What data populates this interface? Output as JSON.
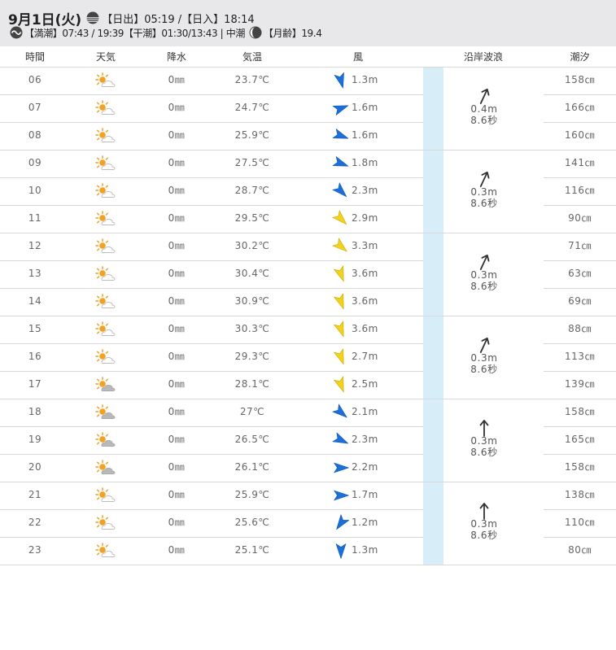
{
  "header": {
    "date": "9月1日(火)",
    "sun_text": "【日出】05:19 /【日入】18:14",
    "tide_text": "【満潮】07:43 / 19:39【干潮】01:30/13:43 | 中潮",
    "moon_text": "【月齢】19.4"
  },
  "columns": [
    "時間",
    "天気",
    "降水",
    "気温",
    "風",
    "沿岸波浪",
    "潮汐"
  ],
  "rows": [
    {
      "hour": "06",
      "weather": "sunny-cloudy-icon",
      "rain": "0㎜",
      "temp": "23.7℃",
      "wind_dir": 165,
      "wind_color": "#1a6fd8",
      "wind": "1.3m",
      "tide": "158㎝"
    },
    {
      "hour": "07",
      "weather": "sunny-cloudy-icon",
      "rain": "0㎜",
      "temp": "24.7℃",
      "wind_dir": 70,
      "wind_color": "#1a6fd8",
      "wind": "1.6m",
      "tide": "166㎝"
    },
    {
      "hour": "08",
      "weather": "sunny-cloudy-icon",
      "rain": "0㎜",
      "temp": "25.9℃",
      "wind_dir": 110,
      "wind_color": "#1a6fd8",
      "wind": "1.6m",
      "tide": "160㎝"
    },
    {
      "hour": "09",
      "weather": "sunny-cloudy-icon",
      "rain": "0㎜",
      "temp": "27.5℃",
      "wind_dir": 110,
      "wind_color": "#1a6fd8",
      "wind": "1.8m",
      "tide": "141㎝"
    },
    {
      "hour": "10",
      "weather": "sunny-cloudy-icon",
      "rain": "0㎜",
      "temp": "28.7℃",
      "wind_dir": 135,
      "wind_color": "#1a6fd8",
      "wind": "2.3m",
      "tide": "116㎝"
    },
    {
      "hour": "11",
      "weather": "sunny-cloudy-icon",
      "rain": "0㎜",
      "temp": "29.5℃",
      "wind_dir": 135,
      "wind_color": "#f2d21a",
      "wind": "2.9m",
      "tide": "90㎝"
    },
    {
      "hour": "12",
      "weather": "sunny-cloudy-icon",
      "rain": "0㎜",
      "temp": "30.2℃",
      "wind_dir": 130,
      "wind_color": "#f2d21a",
      "wind": "3.3m",
      "tide": "71㎝"
    },
    {
      "hour": "13",
      "weather": "sunny-cloudy-icon",
      "rain": "0㎜",
      "temp": "30.4℃",
      "wind_dir": 160,
      "wind_color": "#f2d21a",
      "wind": "3.6m",
      "tide": "63㎝"
    },
    {
      "hour": "14",
      "weather": "sunny-cloudy-icon",
      "rain": "0㎜",
      "temp": "30.9℃",
      "wind_dir": 160,
      "wind_color": "#f2d21a",
      "wind": "3.6m",
      "tide": "69㎝"
    },
    {
      "hour": "15",
      "weather": "sunny-cloudy-icon",
      "rain": "0㎜",
      "temp": "30.3℃",
      "wind_dir": 160,
      "wind_color": "#f2d21a",
      "wind": "3.6m",
      "tide": "88㎝"
    },
    {
      "hour": "16",
      "weather": "sunny-cloudy-icon",
      "rain": "0㎜",
      "temp": "29.3℃",
      "wind_dir": 160,
      "wind_color": "#f2d21a",
      "wind": "2.7m",
      "tide": "113㎝"
    },
    {
      "hour": "17",
      "weather": "cloudy-sun-icon",
      "rain": "0㎜",
      "temp": "28.1℃",
      "wind_dir": 160,
      "wind_color": "#f2d21a",
      "wind": "2.5m",
      "tide": "139㎝"
    },
    {
      "hour": "18",
      "weather": "cloudy-sun-icon",
      "rain": "0㎜",
      "temp": "27℃",
      "wind_dir": 130,
      "wind_color": "#1a6fd8",
      "wind": "2.1m",
      "tide": "158㎝"
    },
    {
      "hour": "19",
      "weather": "cloudy-sun-icon",
      "rain": "0㎜",
      "temp": "26.5℃",
      "wind_dir": 115,
      "wind_color": "#1a6fd8",
      "wind": "2.3m",
      "tide": "165㎝"
    },
    {
      "hour": "20",
      "weather": "cloudy-sun-icon",
      "rain": "0㎜",
      "temp": "26.1℃",
      "wind_dir": 90,
      "wind_color": "#1a6fd8",
      "wind": "2.2m",
      "tide": "158㎝"
    },
    {
      "hour": "21",
      "weather": "sunny-cloudy-icon",
      "rain": "0㎜",
      "temp": "25.9℃",
      "wind_dir": 90,
      "wind_color": "#1a6fd8",
      "wind": "1.7m",
      "tide": "138㎝"
    },
    {
      "hour": "22",
      "weather": "sunny-cloudy-icon",
      "rain": "0㎜",
      "temp": "25.6℃",
      "wind_dir": 215,
      "wind_color": "#1a6fd8",
      "wind": "1.2m",
      "tide": "110㎝"
    },
    {
      "hour": "23",
      "weather": "sunny-cloudy-icon",
      "rain": "0㎜",
      "temp": "25.1℃",
      "wind_dir": 180,
      "wind_color": "#1a6fd8",
      "wind": "1.3m",
      "tide": "80㎝"
    }
  ],
  "waves": [
    {
      "height": "0.4m",
      "period": "8.6秒",
      "dir": 25
    },
    {
      "height": "0.3m",
      "period": "8.6秒",
      "dir": 25
    },
    {
      "height": "0.3m",
      "period": "8.6秒",
      "dir": 25
    },
    {
      "height": "0.3m",
      "period": "8.6秒",
      "dir": 25
    },
    {
      "height": "0.3m",
      "period": "8.6秒",
      "dir": 0
    },
    {
      "height": "0.3m",
      "period": "8.6秒",
      "dir": 0
    }
  ]
}
